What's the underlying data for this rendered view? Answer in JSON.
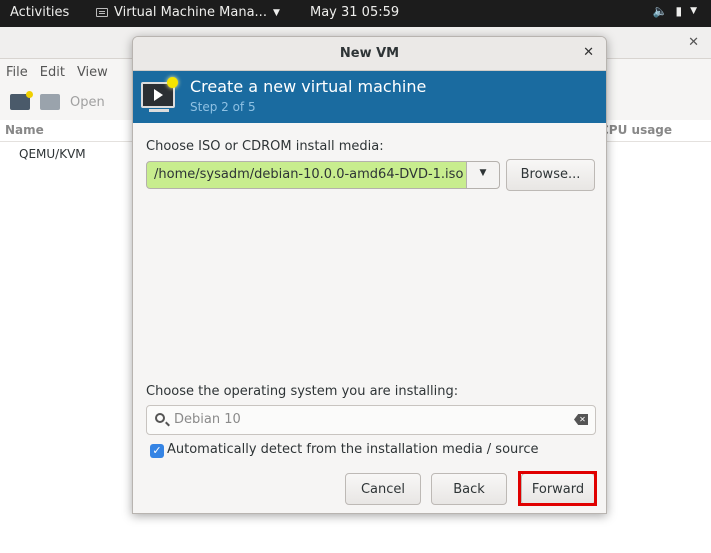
{
  "topbar": {
    "activities": "Activities",
    "app_menu": "Virtual Machine Mana...",
    "clock": "May 31  05:59"
  },
  "main_window": {
    "menu": [
      "File",
      "Edit",
      "View"
    ],
    "toolbar_open": "Open",
    "columns": {
      "name": "Name",
      "cpu": "CPU usage"
    },
    "connection": "QEMU/KVM"
  },
  "dialog": {
    "title": "New VM",
    "banner_title": "Create a new virtual machine",
    "banner_step": "Step 2 of 5",
    "iso_label": "Choose ISO or CDROM install media:",
    "iso_path": "/home/sysadm/debian-10.0.0-amd64-DVD-1.iso",
    "browse_label": "Browse...",
    "os_label": "Choose the operating system you are installing:",
    "os_search_value": "Debian 10",
    "auto_detect_label": "Automatically detect from the installation media / source",
    "auto_detect_checked": true,
    "buttons": {
      "cancel": "Cancel",
      "back": "Back",
      "forward": "Forward"
    }
  },
  "colors": {
    "banner": "#1a6ba0",
    "iso_field": "#c8ed8e",
    "highlight": "#e00000",
    "checkbox": "#3584e4"
  }
}
